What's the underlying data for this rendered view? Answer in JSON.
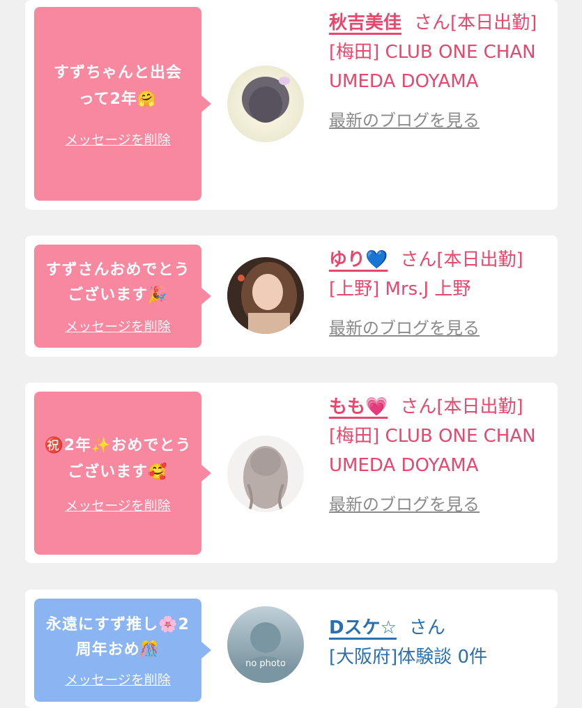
{
  "cards": [
    {
      "message": "すずちゃんと出会って2年🤗",
      "delete_label": "メッセージを削除",
      "name": "秋吉美佳",
      "san": "さん[本日出勤]",
      "shop": "[梅田] CLUB ONE CHAN UMEDA DOYAMA",
      "blog_link": "最新のブログを見る",
      "bubble_color": "#f7889f"
    },
    {
      "message": "すずさんおめでとうございます🎉",
      "delete_label": "メッセージを削除",
      "name": "ゆり💙",
      "san": "さん[本日出勤]",
      "shop": "[上野] Mrs.J 上野",
      "blog_link": "最新のブログを見る",
      "bubble_color": "#f7889f"
    },
    {
      "message": "㊗️2年✨おめでとうございます🥰",
      "delete_label": "メッセージを削除",
      "name": "もも💗",
      "san": "さん[本日出勤]",
      "shop": "[梅田] CLUB ONE CHAN UMEDA DOYAMA",
      "blog_link": "最新のブログを見る",
      "bubble_color": "#f7889f"
    },
    {
      "message": "永遠にすず推し🌸2周年おめ🎊",
      "delete_label": "メッセージを削除",
      "name": "Dスケ☆",
      "san": "さん",
      "shop": "[大阪府]体験談 0件",
      "avatar_text": "no photo",
      "bubble_color": "#8ab5f2"
    }
  ],
  "colors": {
    "pink_text": "#e8476d",
    "blue_text": "#2a6fb0",
    "pink_bubble": "#f7889f",
    "blue_bubble": "#8ab5f2",
    "background": "#f0f0f0"
  }
}
